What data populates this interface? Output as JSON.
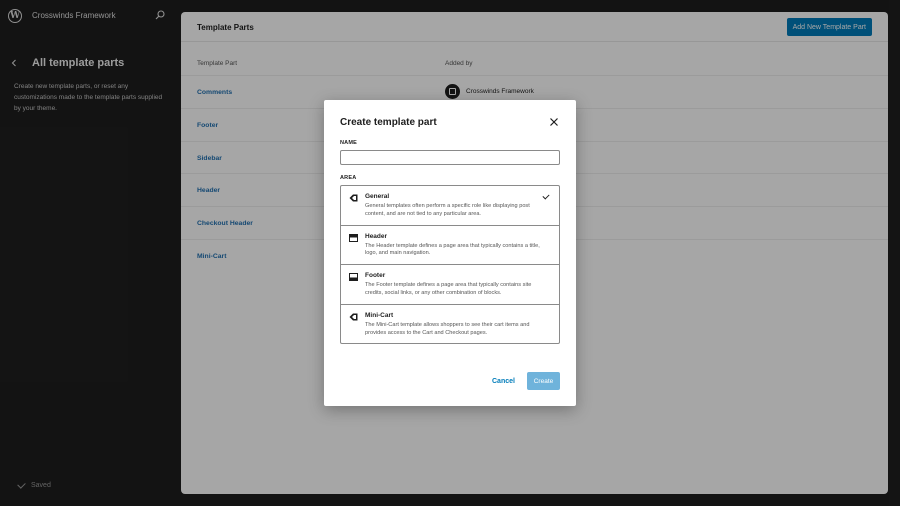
{
  "topbar": {
    "site_name": "Crosswinds Framework"
  },
  "sidebar": {
    "title": "All template parts",
    "description": "Create new template parts, or reset any customizations made to the template parts supplied by your theme.",
    "saved_label": "Saved"
  },
  "main": {
    "title": "Template Parts",
    "add_button": "Add New Template Part",
    "columns": [
      "Template Part",
      "Added by"
    ],
    "rows": [
      {
        "name": "Comments",
        "added_by": "Crosswinds Framework"
      },
      {
        "name": "Footer",
        "added_by": ""
      },
      {
        "name": "Sidebar",
        "added_by": ""
      },
      {
        "name": "Header",
        "added_by": ""
      },
      {
        "name": "Checkout Header",
        "added_by": ""
      },
      {
        "name": "Mini-Cart",
        "added_by": ""
      }
    ]
  },
  "modal": {
    "title": "Create template part",
    "name_label": "NAME",
    "name_value": "",
    "area_label": "AREA",
    "areas": [
      {
        "name": "General",
        "description": "General templates often perform a specific role like displaying post content, and are not tied to any particular area.",
        "icon": "general-icon",
        "selected": true
      },
      {
        "name": "Header",
        "description": "The Header template defines a page area that typically contains a title, logo, and main navigation.",
        "icon": "header-icon",
        "selected": false
      },
      {
        "name": "Footer",
        "description": "The Footer template defines a page area that typically contains site credits, social links, or any other combination of blocks.",
        "icon": "footer-icon",
        "selected": false
      },
      {
        "name": "Mini-Cart",
        "description": "The Mini-Cart template allows shoppers to see their cart items and provides access to the Cart and Checkout pages.",
        "icon": "general-icon",
        "selected": false
      }
    ],
    "cancel_label": "Cancel",
    "create_label": "Create"
  },
  "colors": {
    "accent": "#007cba",
    "sidebar_bg": "#1e1e1e",
    "link": "#2271b1"
  }
}
